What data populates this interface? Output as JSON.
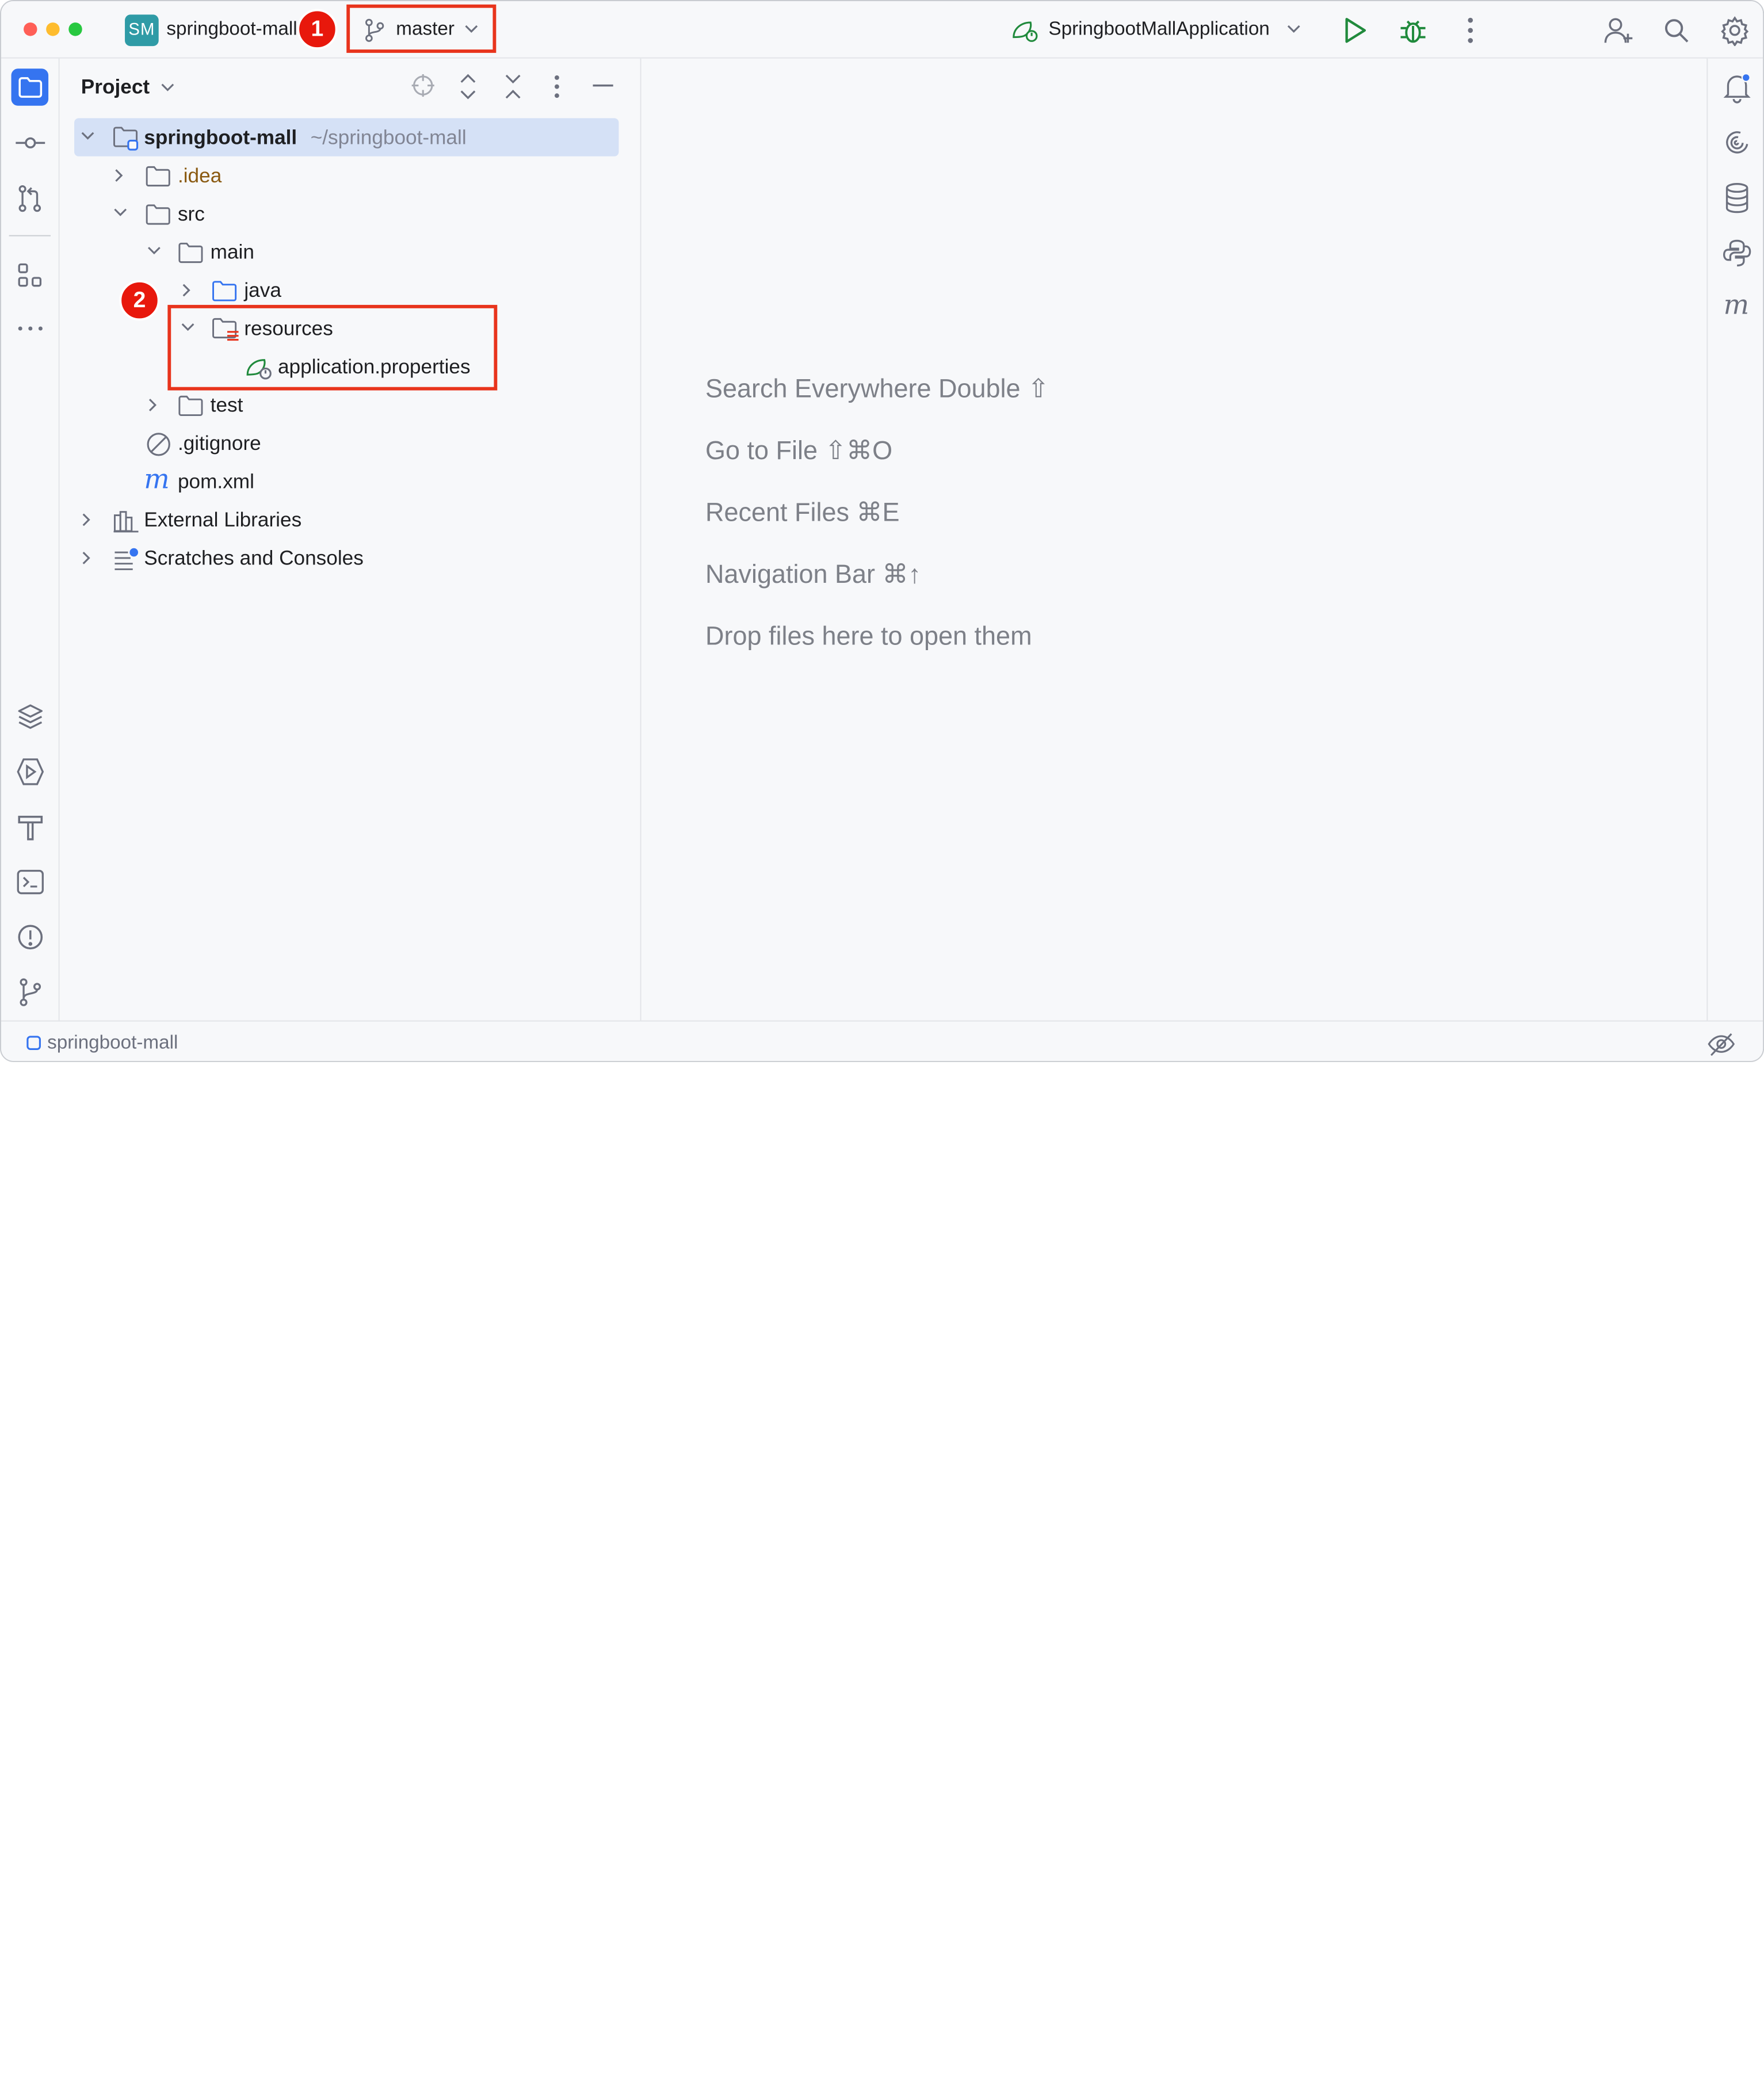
{
  "titlebar": {
    "project_badge": "SM",
    "project_name": "springboot-mall",
    "branch": "master",
    "run_config": "SpringbootMallApplication",
    "colors": {
      "close": "#ff5f57",
      "minimize": "#febc2e",
      "maximize": "#28c840",
      "accent": "#3574f0",
      "run_green": "#208a3c"
    }
  },
  "annotations": {
    "one": "1",
    "two": "2"
  },
  "project_panel": {
    "title": "Project",
    "tree": {
      "root_name": "springboot-mall",
      "root_path": "~/springboot-mall",
      "idea": ".idea",
      "src": "src",
      "main": "main",
      "java": "java",
      "resources": "resources",
      "app_props": "application.properties",
      "test": "test",
      "gitignore": ".gitignore",
      "pom": "pom.xml",
      "ext_libs": "External Libraries",
      "scratches": "Scratches and Consoles"
    }
  },
  "editor_hints": [
    "Search Everywhere Double ⇧",
    "Go to File ⇧⌘O",
    "Recent Files ⌘E",
    "Navigation Bar ⌘↑",
    "Drop files here to open them"
  ],
  "statusbar": {
    "breadcrumb": "springboot-mall"
  }
}
